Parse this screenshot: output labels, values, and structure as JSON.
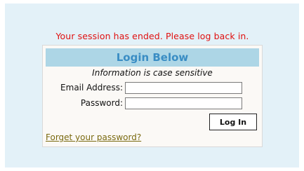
{
  "session_message": "Your session has ended. Please log back in.",
  "login": {
    "header": "Login Below",
    "info": "Information is case sensitive",
    "email_label": "Email Address:",
    "email_value": "",
    "password_label": "Password:",
    "password_value": "",
    "submit_label": "Log In",
    "forgot_link": "Forget your password?"
  },
  "colors": {
    "page_background": "#e3f1f8",
    "error_text": "#e01010",
    "header_background": "#add6e6",
    "header_text": "#3a8dc4",
    "link_text": "#7a6a10"
  }
}
